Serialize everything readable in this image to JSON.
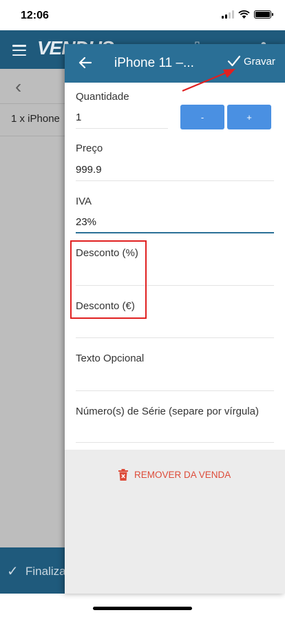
{
  "status_bar": {
    "time": "12:06"
  },
  "background_app": {
    "brand": "VENDUS",
    "item_text": "1 x iPhone",
    "footer_label": "Finaliza"
  },
  "panel": {
    "title": "iPhone 11 –...",
    "save_label": "Gravar",
    "fields": {
      "quantity": {
        "label": "Quantidade",
        "value": "1"
      },
      "price": {
        "label": "Preço",
        "value": "999.9"
      },
      "vat": {
        "label": "IVA",
        "value": "23%"
      },
      "discount_pct": {
        "label": "Desconto (%)",
        "value": ""
      },
      "discount_eur": {
        "label": "Desconto (€)",
        "value": ""
      },
      "optional_text": {
        "label": "Texto Opcional",
        "value": ""
      },
      "serial_numbers": {
        "label": "Número(s) de Série (separe por vírgula)",
        "value": ""
      }
    },
    "decrement_label": "-",
    "increment_label": "+",
    "remove_label": "REMOVER DA VENDA"
  },
  "colors": {
    "header_bg": "#2a6f96",
    "app_bar_bg": "#1f5a7c",
    "qty_button": "#4a90e2",
    "remove_red": "#dd4b39",
    "annotation_red": "#e02020"
  },
  "icons": [
    "back-arrow-icon",
    "checkmark-icon",
    "trash-icon",
    "menu-icon",
    "chevron-left-icon",
    "wifi-icon",
    "battery-icon",
    "signal-icon"
  ]
}
